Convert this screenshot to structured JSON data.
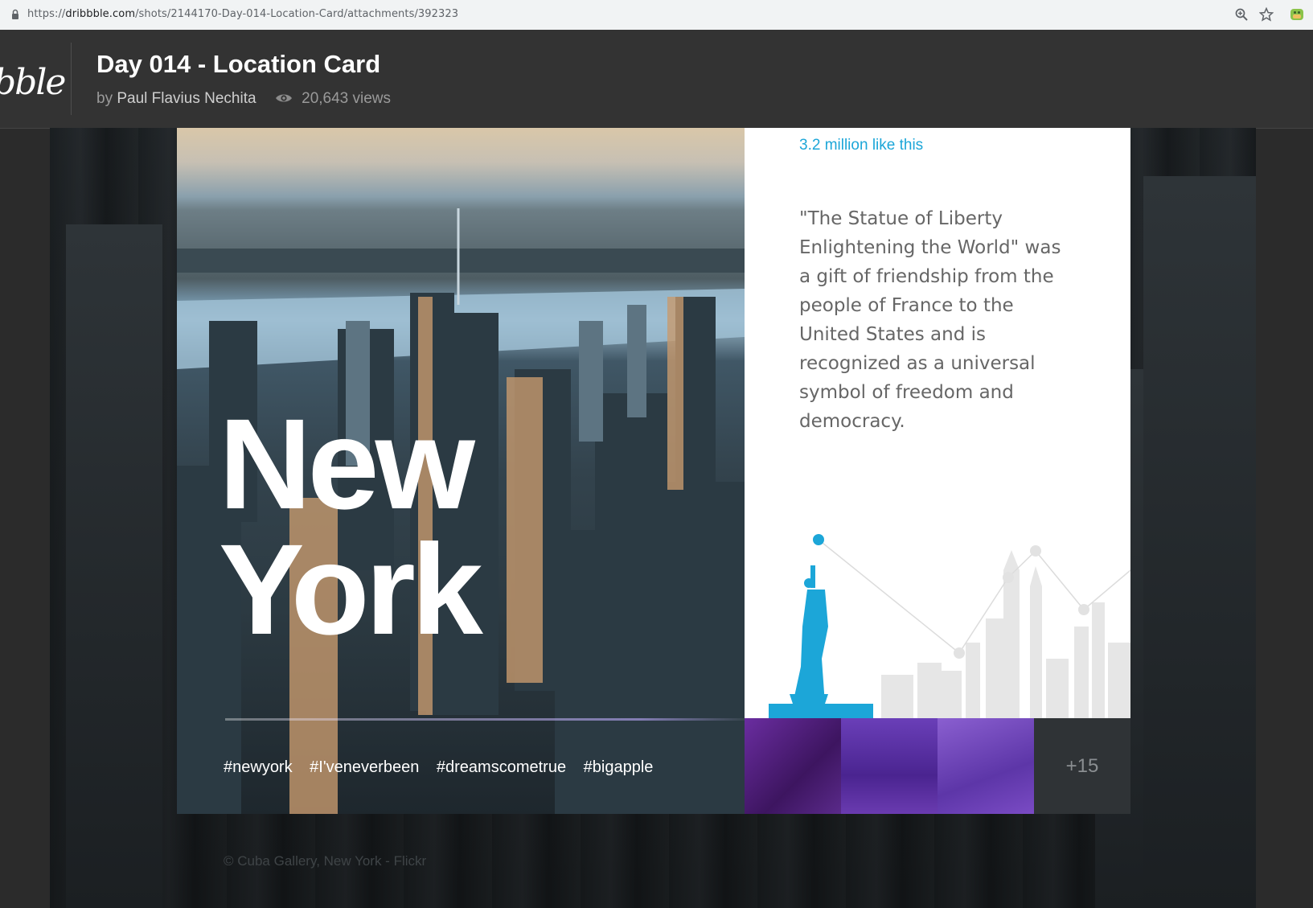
{
  "browser": {
    "url_prefix": "https://",
    "url_domain": "dribbble.com",
    "url_path": "/shots/2144170-Day-014-Location-Card/attachments/392323"
  },
  "header": {
    "logo": "bble",
    "title": "Day 014 - Location Card",
    "by": "by",
    "author": "Paul Flavius Nechita",
    "views": "20,643 views"
  },
  "card": {
    "city_line1": "New",
    "city_line2": "York",
    "likes": "3.2 million like this",
    "description": "\"The Statue of Liberty Enlightening the World\" was a gift of friendship from the people of France to the United States and is recognized as a universal symbol of freedom and democracy.",
    "tags": [
      "#newyork",
      "#I'veneverbeen",
      "#dreamscometrue",
      "#bigapple"
    ],
    "more_photos": "+15",
    "accent": "#1ca6d8"
  },
  "credit": "© Cuba Gallery, New York - Flickr",
  "icons": {
    "lock": "lock-icon",
    "zoom": "zoom-icon",
    "star": "star-icon",
    "eye": "eye-icon"
  }
}
